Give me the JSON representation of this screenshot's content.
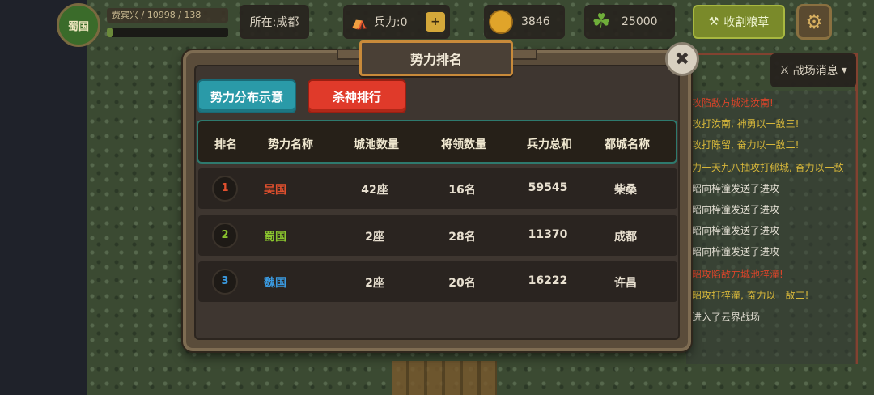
{
  "player": {
    "faction_avatar": "蜀国",
    "name_exp": "费宾兴 / 10998 / 138",
    "exp_progress": 0.05
  },
  "hud": {
    "location": "所在:成都",
    "troops_label": "兵力:0",
    "troops_plus": "+",
    "coins": "3846",
    "food": "25000",
    "harvest_label": "收割粮草",
    "settings_icon": "gear-icon"
  },
  "news": {
    "header": "战场消息",
    "lines": [
      {
        "text": "攻陷敌方城池汝南!",
        "color": "red"
      },
      {
        "text": "攻打汝南, 神勇以一敌三!",
        "color": "yellow"
      },
      {
        "text": "攻打陈留, 奋力以一敌二!",
        "color": "yellow"
      },
      {
        "text": "力一天九八抽攻打郁城, 奋力以一敌",
        "color": "yellow"
      },
      {
        "text": "昭向梓潼发送了进攻",
        "color": "white"
      },
      {
        "text": "昭向梓潼发送了进攻",
        "color": "white"
      },
      {
        "text": "昭向梓潼发送了进攻",
        "color": "white"
      },
      {
        "text": "昭向梓潼发送了进攻",
        "color": "white"
      },
      {
        "text": "昭攻陷敌方城池梓潼!",
        "color": "red"
      },
      {
        "text": "昭攻打梓潼, 奋力以一敌二!",
        "color": "yellow"
      },
      {
        "text": "进入了云界战场",
        "color": "white"
      }
    ]
  },
  "dialog": {
    "title": "势力排名",
    "close_icon": "✖",
    "tabs": {
      "distribution": "势力分布示意",
      "kills": "杀神排行"
    },
    "headers": [
      "排名",
      "势力名称",
      "城池数量",
      "将领数量",
      "兵力总和",
      "都城名称"
    ],
    "rows": [
      {
        "rank": "1",
        "name": "吴国",
        "cities": "42座",
        "generals": "16名",
        "troops": "59545",
        "capital": "柴桑",
        "color": "#e2502e"
      },
      {
        "rank": "2",
        "name": "蜀国",
        "cities": "2座",
        "generals": "28名",
        "troops": "11370",
        "capital": "成都",
        "color": "#8ac42e"
      },
      {
        "rank": "3",
        "name": "魏国",
        "cities": "2座",
        "generals": "20名",
        "troops": "16222",
        "capital": "许昌",
        "color": "#3a9ae0"
      }
    ]
  }
}
